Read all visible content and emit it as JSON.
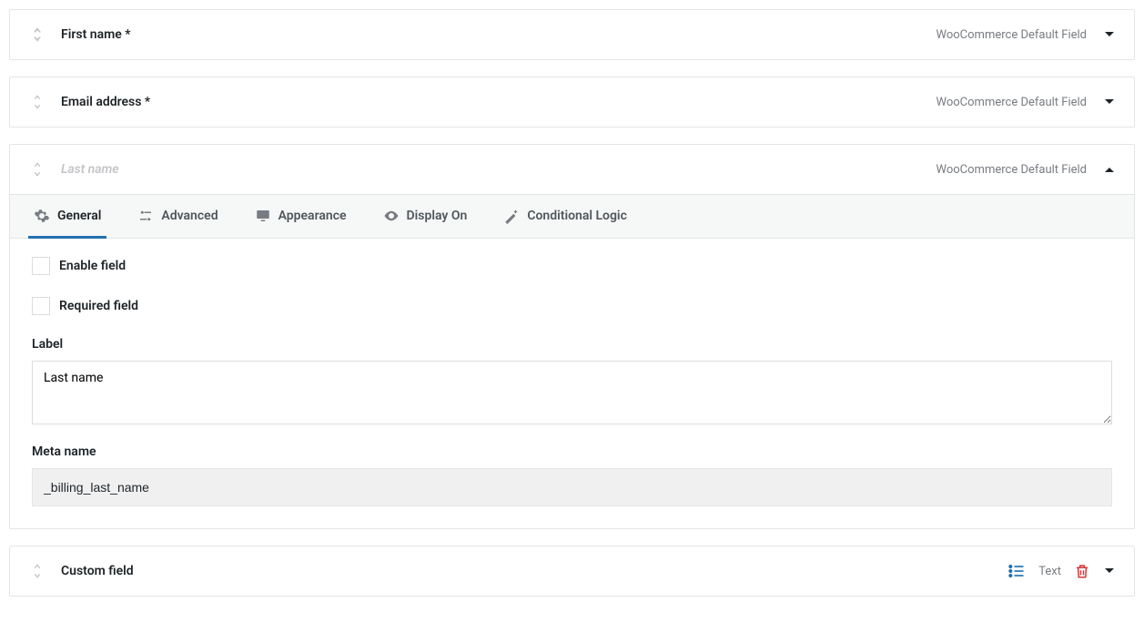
{
  "defaults_badge": "WooCommerce Default Field",
  "fields": [
    {
      "title": "First name *",
      "disabled": false,
      "expanded": false
    },
    {
      "title": "Email address *",
      "disabled": false,
      "expanded": false
    },
    {
      "title": "Last name",
      "disabled": true,
      "expanded": true
    },
    {
      "title": "Custom field",
      "disabled": false,
      "expanded": false,
      "custom": true,
      "type_label": "Text"
    }
  ],
  "tabs": {
    "general": "General",
    "advanced": "Advanced",
    "appearance": "Appearance",
    "display_on": "Display On",
    "conditional": "Conditional Logic"
  },
  "general": {
    "enable_label": "Enable field",
    "required_label": "Required field",
    "label_label": "Label",
    "label_value": "Last name",
    "meta_label": "Meta name",
    "meta_value": "_billing_last_name"
  }
}
